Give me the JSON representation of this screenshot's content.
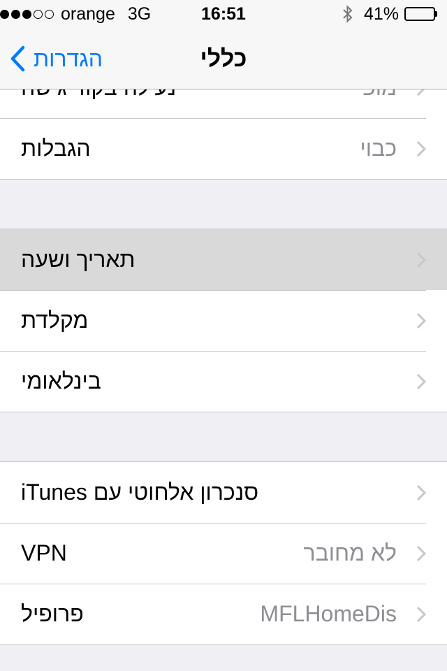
{
  "status_bar": {
    "signal_bars_filled": 3,
    "signal_bars_total": 5,
    "carrier": "orange",
    "network": "3G",
    "time": "16:51",
    "battery_percent": "41%",
    "battery_level": 0.41
  },
  "navbar": {
    "back_label": "הגדרות",
    "title": "כללי"
  },
  "groups": [
    {
      "rows": [
        {
          "label": "נעילה בקוד גישה",
          "value": "מופ"
        },
        {
          "label": "הגבלות",
          "value": "כבוי"
        }
      ]
    },
    {
      "rows": [
        {
          "label": "תאריך ושעה",
          "value": ""
        },
        {
          "label": "מקלדת",
          "value": ""
        },
        {
          "label": "בינלאומי",
          "value": ""
        }
      ]
    },
    {
      "rows": [
        {
          "label": "סנכרון אלחוטי עם iTunes",
          "value": ""
        },
        {
          "label": "VPN",
          "value": "לא מחובר"
        },
        {
          "label": "פרופיל",
          "value": "MFLHomeDis"
        }
      ]
    }
  ],
  "colors": {
    "accent": "#007aff",
    "background": "#efeff4",
    "separator": "#c8c7cc",
    "secondary_text": "#8e8e93",
    "highlight": "#d9d9d9"
  }
}
